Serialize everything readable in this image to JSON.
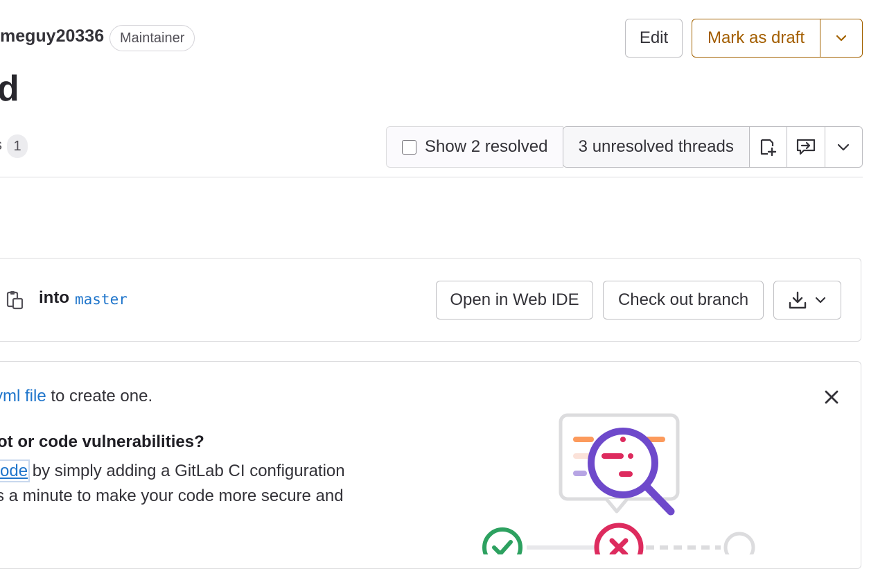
{
  "header": {
    "author": "meguy20336",
    "role_badge": "Maintainer",
    "edit_label": "Edit",
    "draft_label": "Mark as draft",
    "title_fragment": "d"
  },
  "tabs": {
    "fragment": "s",
    "count": "1"
  },
  "discussion_toolbar": {
    "show_resolved_label": "Show 2 resolved",
    "show_resolved_checked": false,
    "unresolved_threads_label": "3 unresolved threads"
  },
  "branch_card": {
    "into_label": "into",
    "target_branch": "master",
    "open_ide_label": "Open in Web IDE",
    "checkout_label": "Check out branch"
  },
  "pipeline_card": {
    "line1_link": "yml file",
    "line1_text": " to create one.",
    "heading": "ot or code vulnerabilities?",
    "para1_link": "ode",
    "para1_text": " by simply adding a GitLab CI configuration",
    "para2_text": "s a minute to make your code more secure and"
  },
  "colors": {
    "link": "#1f75cb",
    "draft_accent": "#a36200",
    "success": "#2da160",
    "danger": "#dd2b5e",
    "purple": "#6e49cb"
  }
}
